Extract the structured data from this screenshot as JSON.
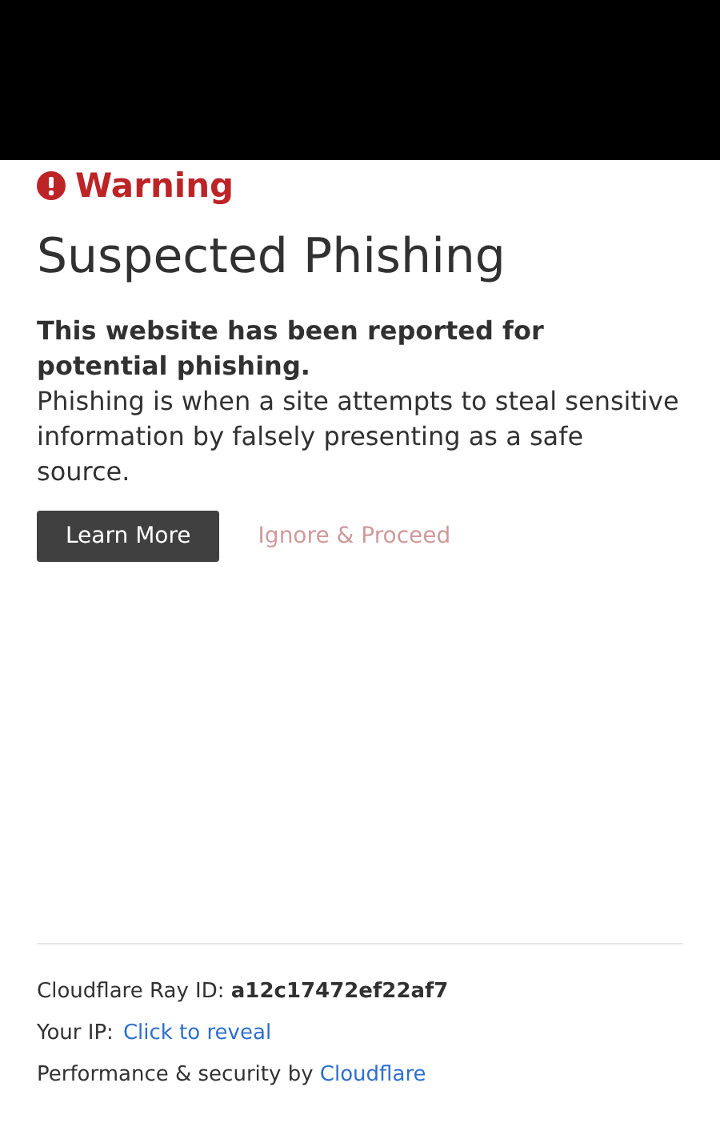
{
  "warning": {
    "label": "Warning"
  },
  "title": "Suspected Phishing",
  "lead": "This website has been reported for potential phishing.",
  "description": "Phishing is when a site attempts to steal sensitive information by falsely presenting as a safe source.",
  "buttons": [
    {
      "label": "Learn More",
      "kind": "primary"
    },
    {
      "label": "Ignore & Proceed",
      "kind": "link"
    }
  ],
  "footer": {
    "ray": "Cloudflare Ray ID: **a12c17472ef22af7**",
    "ip_label": "Your IP:",
    "ip_link": "Click to reveal",
    "perf_text": "Performance & security by",
    "perf_link": "Cloudflare"
  }
}
